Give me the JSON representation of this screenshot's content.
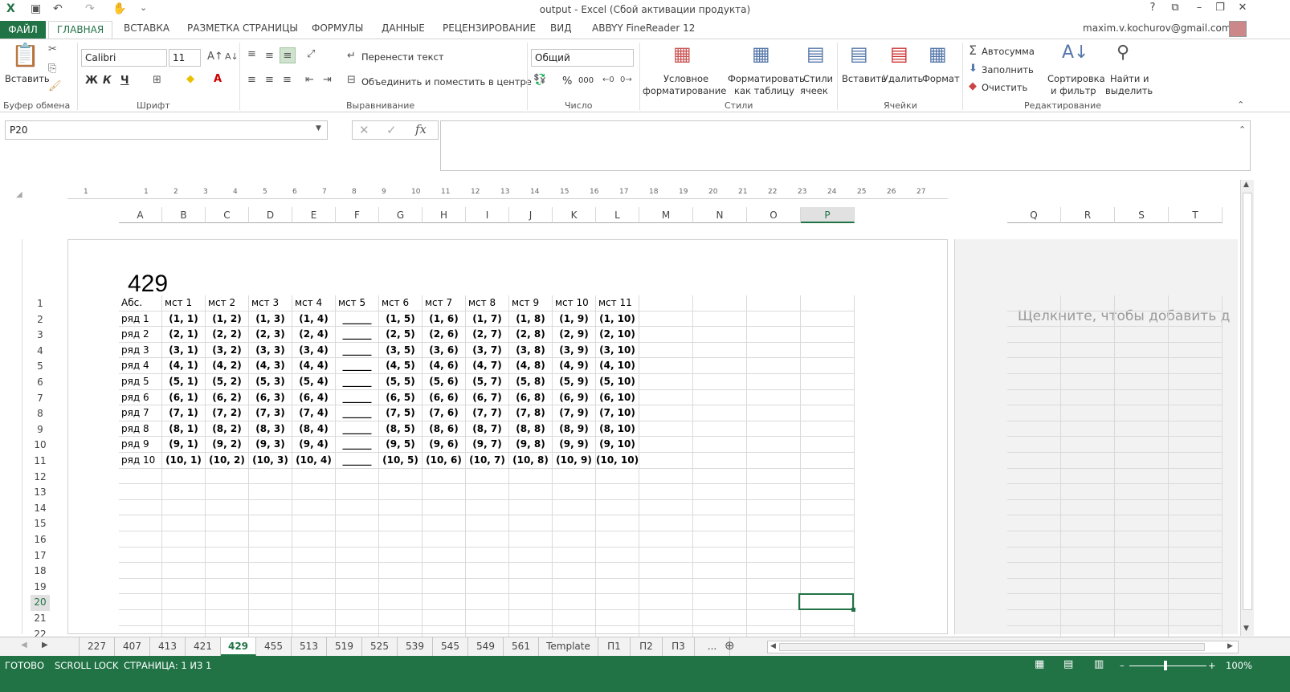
{
  "window": {
    "title": "output - Excel (Сбой активации продукта)",
    "help": "?",
    "user": "maxim.v.kochurov@gmail.com"
  },
  "tabs": [
    "ВСТАВКА",
    "РАЗМЕТКА СТРАНИЦЫ",
    "ФОРМУЛЫ",
    "ДАННЫЕ",
    "РЕЦЕНЗИРОВАНИЕ",
    "ВИД",
    "ABBYY FineReader 12"
  ],
  "file_tab": "ФАЙЛ",
  "home_tab": "ГЛАВНАЯ",
  "ribbon": {
    "paste": "Вставить",
    "clipboard": "Буфер обмена",
    "font_name": "Calibri",
    "font_size": "11",
    "bold": "Ж",
    "italic": "К",
    "underline": "Ч",
    "font_group": "Шрифт",
    "wrap_text": "Перенести текст",
    "merge_center": "Объединить и поместить в центре",
    "alignment": "Выравнивание",
    "number_format": "Общий",
    "number": "Число",
    "percent": "%",
    "thousands": "000",
    "cond_format_1": "Условное",
    "cond_format_2": "форматирование",
    "format_table_1": "Форматировать",
    "format_table_2": "как таблицу",
    "cell_styles_1": "Стили",
    "cell_styles_2": "ячеек",
    "styles": "Стили",
    "insert": "Вставить",
    "delete": "Удалить",
    "format": "Формат",
    "cells": "Ячейки",
    "autosum": "Автосумма",
    "fill": "Заполнить",
    "clear": "Очистить",
    "sort_1": "Сортировка",
    "sort_2": "и фильтр",
    "find_1": "Найти и",
    "find_2": "выделить",
    "editing": "Редактирование"
  },
  "namebox": "P20",
  "fx": "fx",
  "ruler_numbers": [
    "1",
    "1",
    "2",
    "3",
    "4",
    "5",
    "6",
    "7",
    "8",
    "9",
    "10",
    "11",
    "12",
    "13",
    "14",
    "15",
    "16",
    "17",
    "18",
    "19",
    "20",
    "21",
    "22",
    "23",
    "24",
    "25",
    "26",
    "27"
  ],
  "columns": [
    "A",
    "B",
    "C",
    "D",
    "E",
    "F",
    "G",
    "H",
    "I",
    "J",
    "K",
    "L",
    "M",
    "N",
    "O",
    "P"
  ],
  "columns_right": [
    "Q",
    "R",
    "S",
    "T"
  ],
  "page_title": "429",
  "header_row": [
    "Абс.",
    "мст 1",
    "мст 2",
    "мст 3",
    "мст 4",
    "мст 5",
    "мст 6",
    "мст 7",
    "мст 8",
    "мст 9",
    "мст 10",
    "мст 11"
  ],
  "rows": [
    [
      "ряд 1",
      "(1, 1)",
      "(1, 2)",
      "(1, 3)",
      "(1, 4)",
      "______",
      "(1, 5)",
      "(1, 6)",
      "(1, 7)",
      "(1, 8)",
      "(1, 9)",
      "(1, 10)"
    ],
    [
      "ряд 2",
      "(2, 1)",
      "(2, 2)",
      "(2, 3)",
      "(2, 4)",
      "______",
      "(2, 5)",
      "(2, 6)",
      "(2, 7)",
      "(2, 8)",
      "(2, 9)",
      "(2, 10)"
    ],
    [
      "ряд 3",
      "(3, 1)",
      "(3, 2)",
      "(3, 3)",
      "(3, 4)",
      "______",
      "(3, 5)",
      "(3, 6)",
      "(3, 7)",
      "(3, 8)",
      "(3, 9)",
      "(3, 10)"
    ],
    [
      "ряд 4",
      "(4, 1)",
      "(4, 2)",
      "(4, 3)",
      "(4, 4)",
      "______",
      "(4, 5)",
      "(4, 6)",
      "(4, 7)",
      "(4, 8)",
      "(4, 9)",
      "(4, 10)"
    ],
    [
      "ряд 5",
      "(5, 1)",
      "(5, 2)",
      "(5, 3)",
      "(5, 4)",
      "______",
      "(5, 5)",
      "(5, 6)",
      "(5, 7)",
      "(5, 8)",
      "(5, 9)",
      "(5, 10)"
    ],
    [
      "ряд 6",
      "(6, 1)",
      "(6, 2)",
      "(6, 3)",
      "(6, 4)",
      "______",
      "(6, 5)",
      "(6, 6)",
      "(6, 7)",
      "(6, 8)",
      "(6, 9)",
      "(6, 10)"
    ],
    [
      "ряд 7",
      "(7, 1)",
      "(7, 2)",
      "(7, 3)",
      "(7, 4)",
      "______",
      "(7, 5)",
      "(7, 6)",
      "(7, 7)",
      "(7, 8)",
      "(7, 9)",
      "(7, 10)"
    ],
    [
      "ряд 8",
      "(8, 1)",
      "(8, 2)",
      "(8, 3)",
      "(8, 4)",
      "______",
      "(8, 5)",
      "(8, 6)",
      "(8, 7)",
      "(8, 8)",
      "(8, 9)",
      "(8, 10)"
    ],
    [
      "ряд 9",
      "(9, 1)",
      "(9, 2)",
      "(9, 3)",
      "(9, 4)",
      "______",
      "(9, 5)",
      "(9, 6)",
      "(9, 7)",
      "(9, 8)",
      "(9, 9)",
      "(9, 10)"
    ],
    [
      "ряд 10",
      "(10, 1)",
      "(10, 2)",
      "(10, 3)",
      "(10, 4)",
      "______",
      "(10, 5)",
      "(10, 6)",
      "(10, 7)",
      "(10, 8)",
      "(10, 9)",
      "(10, 10)"
    ]
  ],
  "row_numbers": [
    "1",
    "2",
    "3",
    "4",
    "5",
    "6",
    "7",
    "8",
    "9",
    "10",
    "11",
    "12",
    "13",
    "14",
    "15",
    "16",
    "17",
    "18",
    "19",
    "20",
    "21",
    "22"
  ],
  "right_page_hint": "Щелкните, чтобы добавить д",
  "sheet_tabs": [
    "227",
    "407",
    "413",
    "421",
    "429",
    "455",
    "513",
    "519",
    "525",
    "539",
    "545",
    "549",
    "561",
    "Template",
    "П1",
    "П2",
    "П3",
    "..."
  ],
  "active_sheet": "429",
  "status": {
    "ready": "ГОТОВО",
    "scroll_lock": "SCROLL LOCK",
    "page": "СТРАНИЦА: 1 ИЗ 1",
    "zoom": "100%"
  },
  "colors": {
    "accent": "#217346",
    "selection": "#217346"
  }
}
